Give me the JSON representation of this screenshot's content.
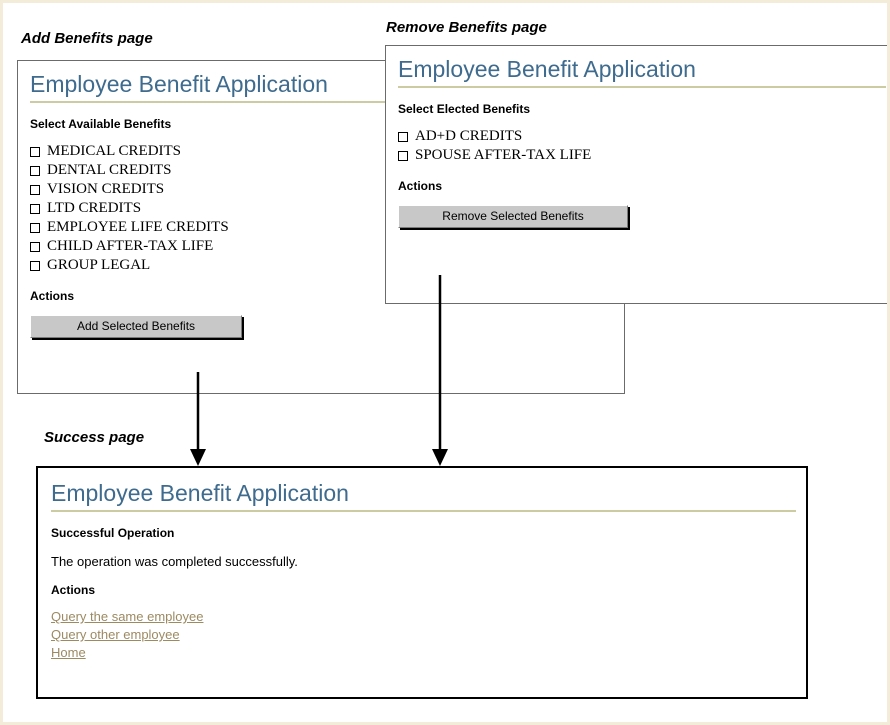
{
  "diagram": {
    "labels": {
      "add_page": "Add Benefits page",
      "remove_page": "Remove Benefits page",
      "success_page_right": "Success page",
      "success_page_bottom": "Success page"
    }
  },
  "add_panel": {
    "app_title": "Employee Benefit Application",
    "section_heading": "Select Available Benefits",
    "benefits": [
      "MEDICAL CREDITS",
      "DENTAL CREDITS",
      "VISION CREDITS",
      "LTD CREDITS",
      "EMPLOYEE LIFE CREDITS",
      "CHILD AFTER-TAX LIFE",
      "GROUP LEGAL"
    ],
    "actions_heading": "Actions",
    "submit_label": "Add Selected Benefits"
  },
  "remove_panel": {
    "app_title": "Employee Benefit Application",
    "section_heading": "Select Elected Benefits",
    "benefits": [
      "AD+D CREDITS",
      "SPOUSE AFTER-TAX LIFE"
    ],
    "actions_heading": "Actions",
    "submit_label": "Remove Selected Benefits"
  },
  "success_panel": {
    "app_title": "Employee Benefit Application",
    "section_heading": "Successful Operation",
    "message": "The operation was completed successfully.",
    "actions_heading": "Actions",
    "links": [
      "Query the same employee",
      "Query other employee",
      "Home"
    ]
  },
  "colors": {
    "app_title": "#3e6b8e",
    "title_rule": "#cdcba2",
    "link": "#9c8a62",
    "button_face": "#c8c8c8",
    "page_border": "#f2ecd8"
  }
}
